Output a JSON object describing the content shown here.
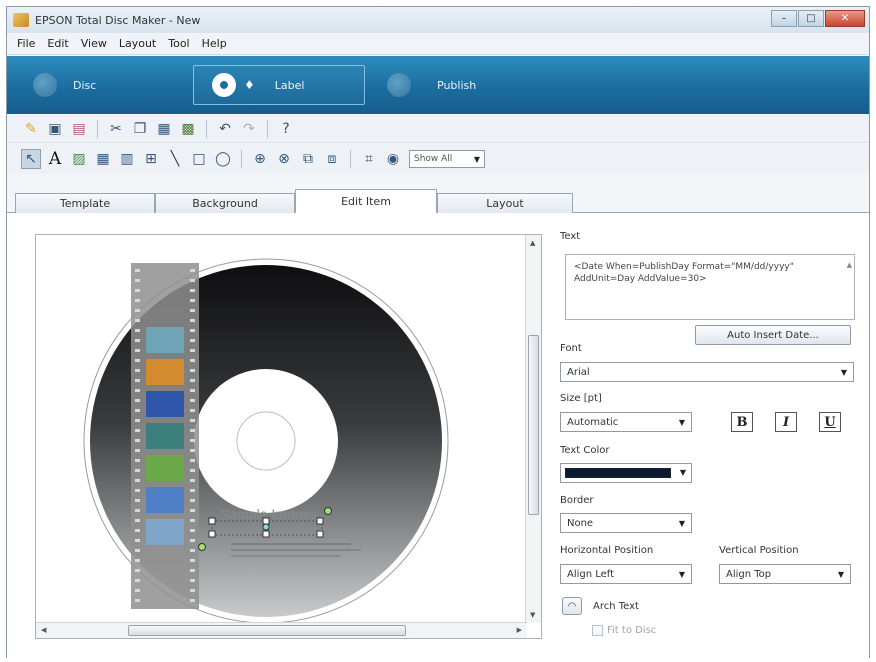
{
  "window": {
    "title": "EPSON Total Disc Maker - New"
  },
  "menu": [
    "File",
    "Edit",
    "View",
    "Layout",
    "Tool",
    "Help"
  ],
  "modes": {
    "disc": "Disc",
    "label": "Label",
    "publish": "Publish"
  },
  "toolbar": {
    "show_all": "Show All"
  },
  "tabs": {
    "template": "Template",
    "background": "Background",
    "edit_item": "Edit Item",
    "layout": "Layout"
  },
  "canvas": {
    "sample_text": "Sample Images"
  },
  "panel": {
    "text_label": "Text",
    "text_value": "<Date When=PublishDay Format=\"MM/dd/yyyy\" AddUnit=Day AddValue=30>",
    "auto_insert_button": "Auto Insert Date...",
    "font_label": "Font",
    "font_value": "Arial",
    "size_label": "Size [pt]",
    "size_value": "Automatic",
    "bold": "B",
    "italic": "I",
    "underline": "U",
    "text_color_label": "Text Color",
    "text_color_value": "#0b1a33",
    "border_label": "Border",
    "border_value": "None",
    "hpos_label": "Horizontal Position",
    "hpos_value": "Align Left",
    "vpos_label": "Vertical Position",
    "vpos_value": "Align Top",
    "arch_text_label": "Arch Text",
    "fit_to_disc_label": "Fit to Disc"
  }
}
